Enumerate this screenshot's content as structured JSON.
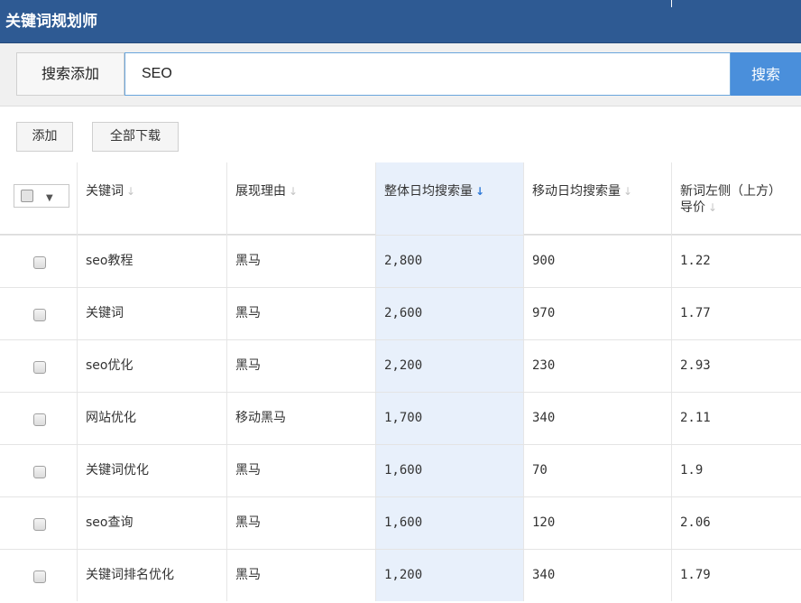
{
  "app": {
    "title": "关键词规划师"
  },
  "search": {
    "label": "搜索添加",
    "value": "SEO",
    "button": "搜索"
  },
  "toolbar": {
    "add": "添加",
    "download_all": "全部下载"
  },
  "columns": {
    "keyword": "关键词",
    "reason": "展现理由",
    "daily_total": "整体日均搜索量",
    "daily_mobile": "移动日均搜索量",
    "bid_line1": "新词左侧（上方）",
    "bid_line2": "导价"
  },
  "sort_icons": {
    "inactive": "↓",
    "active": "↓"
  },
  "rows": [
    {
      "keyword": "seo教程",
      "reason": "黑马",
      "total": "2,800",
      "mobile": "900",
      "bid": "1.22"
    },
    {
      "keyword": "关键词",
      "reason": "黑马",
      "total": "2,600",
      "mobile": "970",
      "bid": "1.77"
    },
    {
      "keyword": "seo优化",
      "reason": "黑马",
      "total": "2,200",
      "mobile": "230",
      "bid": "2.93"
    },
    {
      "keyword": "网站优化",
      "reason": "移动黑马",
      "total": "1,700",
      "mobile": "340",
      "bid": "2.11"
    },
    {
      "keyword": "关键词优化",
      "reason": "黑马",
      "total": "1,600",
      "mobile": "70",
      "bid": "1.9"
    },
    {
      "keyword": "seo查询",
      "reason": "黑马",
      "total": "1,600",
      "mobile": "120",
      "bid": "2.06"
    },
    {
      "keyword": "关键词排名优化",
      "reason": "黑马",
      "total": "1,200",
      "mobile": "340",
      "bid": "1.79"
    }
  ],
  "colors": {
    "titlebar": "#2e5a93",
    "accent": "#4a8fdb",
    "sorted_column": "#e8f0fb"
  }
}
